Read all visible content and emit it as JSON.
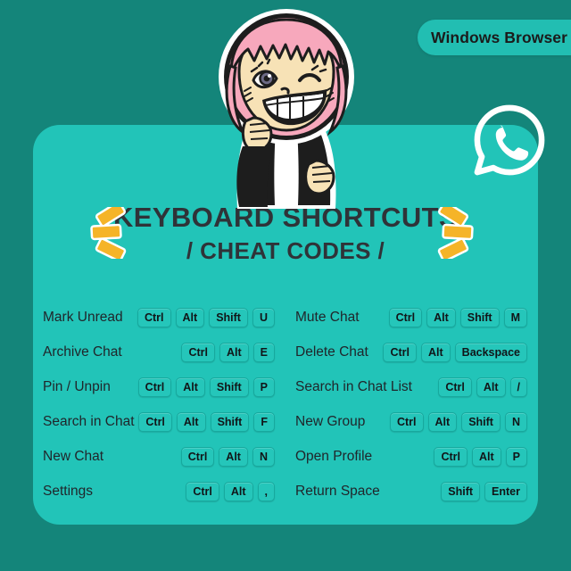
{
  "badge": {
    "label": "Windows Browser",
    "color": "#22beb2"
  },
  "logo": {
    "name": "whatsapp-logo",
    "color": "#ffffff"
  },
  "character": {
    "name": "cartoon-girl-sticker"
  },
  "title": {
    "line1": "KEYBOARD SHORTCUTS",
    "line2": "/ CHEAT CODES /",
    "color": "#2f3338"
  },
  "decorations": {
    "burst_left": "starburst-left",
    "burst_right": "starburst-right",
    "burst_color": "#f5b428"
  },
  "theme": {
    "background": "#14857a",
    "card": "#22c4b8",
    "key_chip": "#25c6ba",
    "text": "#20262b"
  },
  "columns": [
    {
      "rows": [
        {
          "label": "Mark Unread",
          "keys": [
            "Ctrl",
            "Alt",
            "Shift",
            "U"
          ]
        },
        {
          "label": "Archive Chat",
          "keys": [
            "Ctrl",
            "Alt",
            "E"
          ]
        },
        {
          "label": "Pin / Unpin",
          "keys": [
            "Ctrl",
            "Alt",
            "Shift",
            "P"
          ]
        },
        {
          "label": "Search in Chat",
          "keys": [
            "Ctrl",
            "Alt",
            "Shift",
            "F"
          ]
        },
        {
          "label": "New Chat",
          "keys": [
            "Ctrl",
            "Alt",
            "N"
          ]
        },
        {
          "label": "Settings",
          "keys": [
            "Ctrl",
            "Alt",
            ","
          ]
        }
      ]
    },
    {
      "rows": [
        {
          "label": "Mute Chat",
          "keys": [
            "Ctrl",
            "Alt",
            "Shift",
            "M"
          ]
        },
        {
          "label": "Delete Chat",
          "keys": [
            "Ctrl",
            "Alt",
            "Backspace"
          ]
        },
        {
          "label": "Search in Chat List",
          "keys": [
            "Ctrl",
            "Alt",
            "/"
          ]
        },
        {
          "label": "New Group",
          "keys": [
            "Ctrl",
            "Alt",
            "Shift",
            "N"
          ]
        },
        {
          "label": "Open Profile",
          "keys": [
            "Ctrl",
            "Alt",
            "P"
          ]
        },
        {
          "label": "Return Space",
          "keys": [
            "Shift",
            "Enter"
          ]
        }
      ]
    }
  ]
}
